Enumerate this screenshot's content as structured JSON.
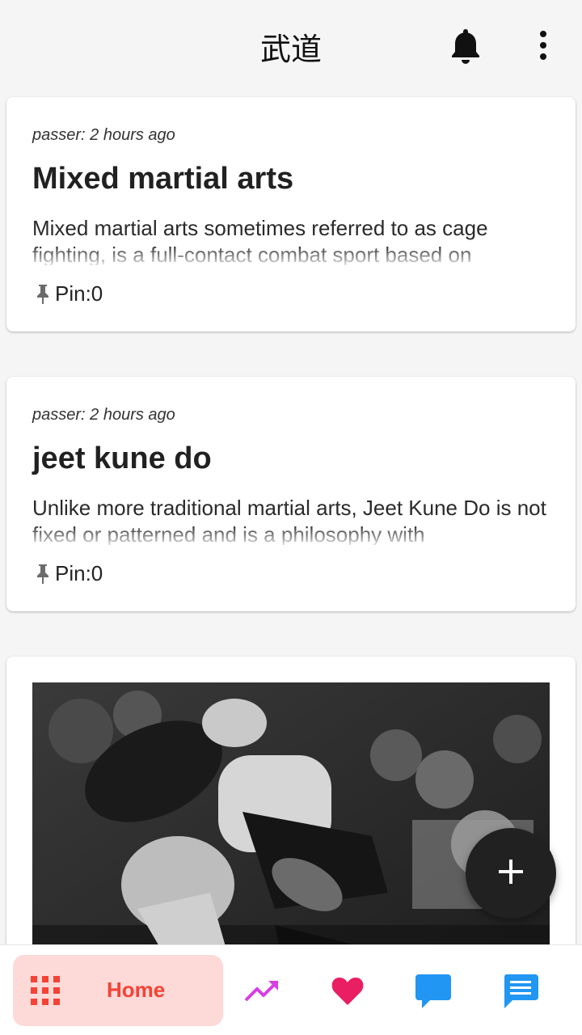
{
  "appbar": {
    "title": "武道",
    "icons": [
      "bell-icon",
      "more-vertical-icon"
    ]
  },
  "feed": {
    "posts": [
      {
        "meta": "passer: 2 hours ago",
        "title": "Mixed martial arts",
        "excerpt": "Mixed martial arts sometimes referred to as cage fighting, is a full-contact combat sport based on",
        "pin_label": "Pin:0"
      },
      {
        "meta": "passer: 2 hours ago",
        "title": "jeet kune do",
        "excerpt": "Unlike more traditional martial arts, Jeet Kune Do is not fixed or patterned and is a philosophy with",
        "pin_label": "Pin:0"
      },
      {
        "image": "wrestling-photo"
      }
    ]
  },
  "fab": {
    "icon": "plus-icon"
  },
  "bottom_nav": {
    "home_label": "Home",
    "items": [
      "grid-icon",
      "trending-icon",
      "heart-icon",
      "chat-bubble-icon",
      "message-icon"
    ]
  },
  "colors": {
    "background": "#f5f5f5",
    "home_active_bg": "#fdd9d7",
    "home_active_fg": "#f44336",
    "trending": "#d63ee6",
    "heart": "#e91e63",
    "chat": "#2196f3",
    "fab": "#212121"
  }
}
